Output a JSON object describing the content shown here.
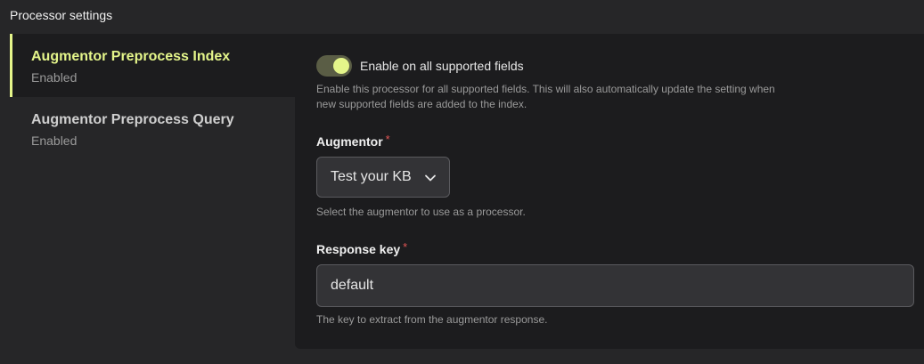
{
  "header": {
    "title": "Processor settings"
  },
  "sidebar": {
    "items": [
      {
        "name": "Augmentor Preprocess Index",
        "status": "Enabled",
        "active": true
      },
      {
        "name": "Augmentor Preprocess Query",
        "status": "Enabled",
        "active": false
      }
    ]
  },
  "settings": {
    "toggle": {
      "label": "Enable on all supported fields",
      "on": true,
      "help": "Enable this processor for all supported fields. This will also automatically update the setting when new supported fields are added to the index."
    },
    "augmentor": {
      "label": "Augmentor",
      "required": "*",
      "value": "Test your KB",
      "help": "Select the augmentor to use as a processor."
    },
    "response_key": {
      "label": "Response key",
      "required": "*",
      "value": "default",
      "help": "The key to extract from the augmentor response."
    }
  },
  "colors": {
    "accent": "#e4f58a",
    "required": "#e05555",
    "background": "#262628",
    "panel": "#1c1c1e"
  },
  "icons": {
    "select": "chevron-down-icon"
  }
}
